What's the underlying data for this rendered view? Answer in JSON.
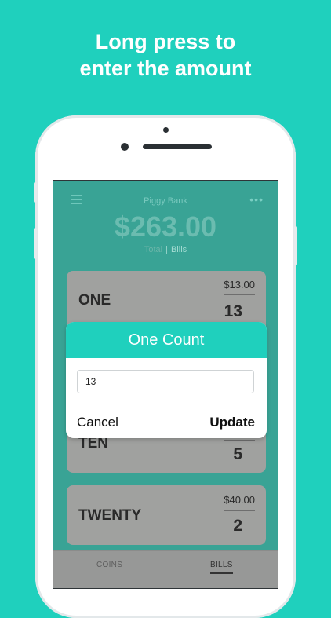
{
  "promo": {
    "line1": "Long press to",
    "line2": "enter the amount"
  },
  "colors": {
    "background": "#1fd0bd",
    "accent": "#1fd0bd",
    "screen_dimmed": "#39a395",
    "card_dimmed": "#a0a19f"
  },
  "app": {
    "title": "Piggy Bank",
    "total": "$263.00",
    "tabs": {
      "total": "Total",
      "separator": "|",
      "bills": "Bills"
    },
    "menu_icon": "hamburger-icon",
    "more_icon": "ellipsis-icon"
  },
  "cards": [
    {
      "name": "ONE",
      "amount": "$13.00",
      "count": "13"
    },
    {
      "name": "TEN",
      "amount": "",
      "count": "5"
    },
    {
      "name": "TWENTY",
      "amount": "$40.00",
      "count": "2"
    }
  ],
  "bottom_tabs": {
    "coins": "COINS",
    "bills": "BILLS"
  },
  "dialog": {
    "title": "One Count",
    "input_value": "13",
    "cancel_label": "Cancel",
    "update_label": "Update"
  }
}
